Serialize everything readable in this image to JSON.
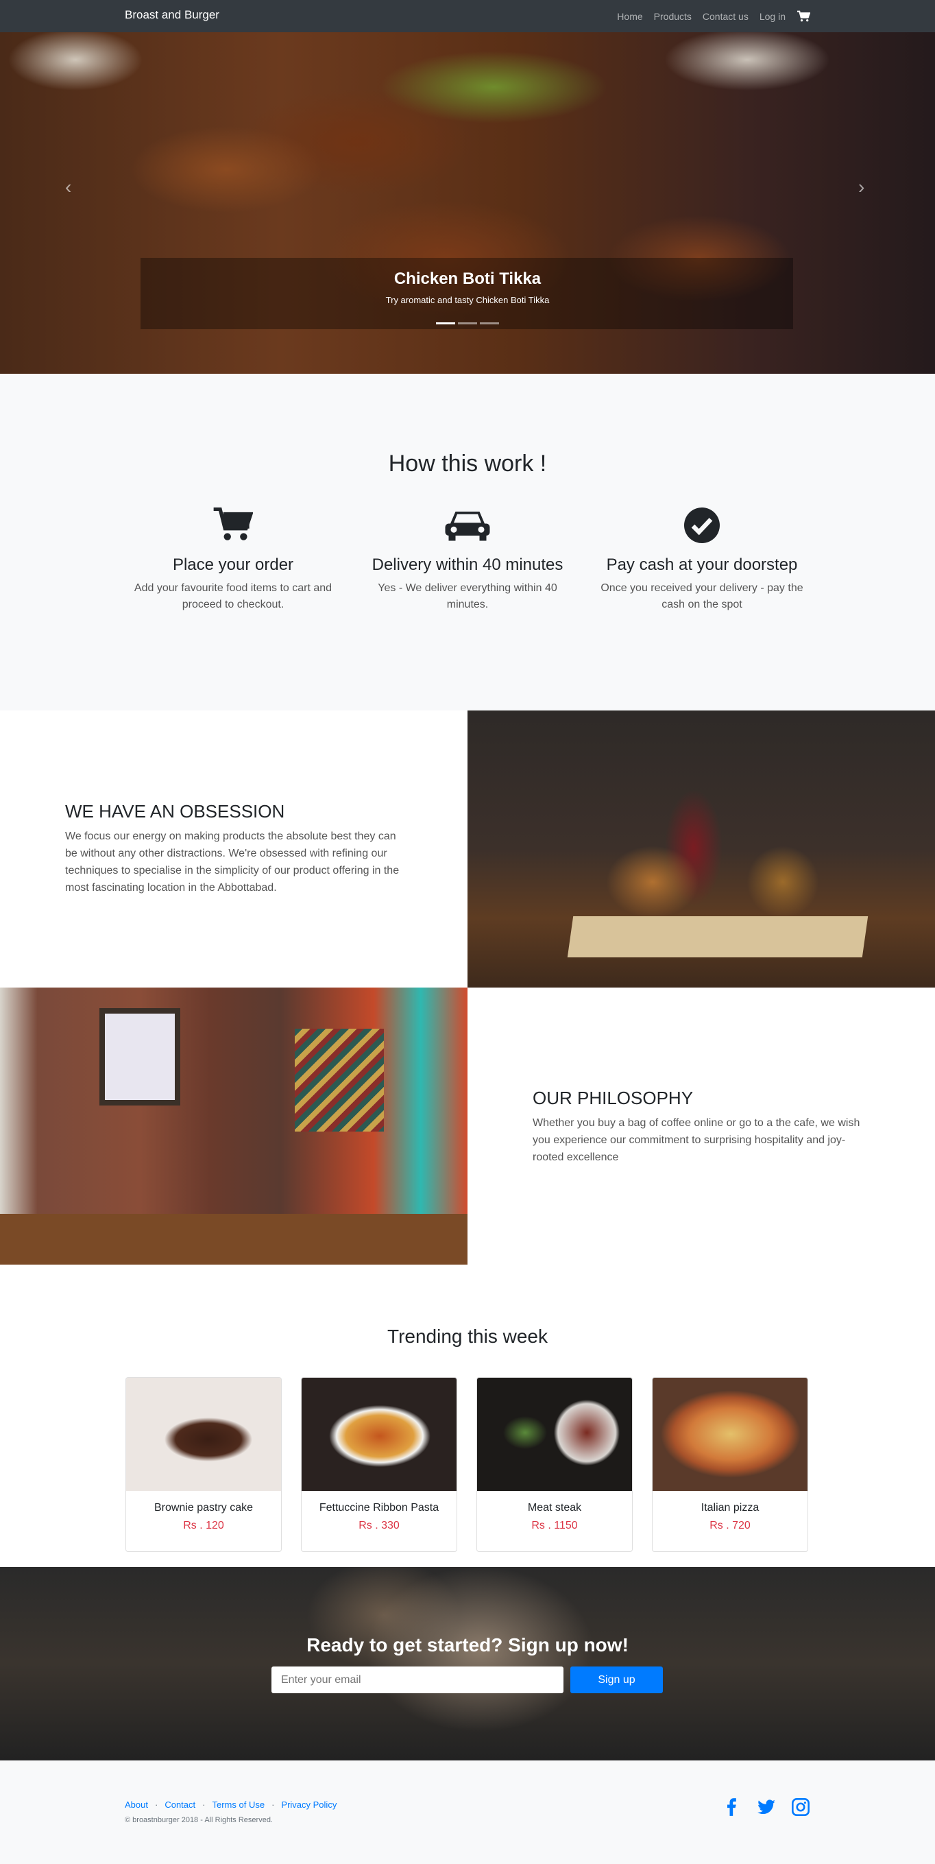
{
  "navbar": {
    "brand": "Broast and Burger",
    "links": [
      "Home",
      "Products",
      "Contact us",
      "Log in"
    ]
  },
  "hero": {
    "title": "Chicken Boti Tikka",
    "subtitle": "Try aromatic and tasty Chicken Boti Tikka",
    "slide_count": 3,
    "active_slide": 1
  },
  "how": {
    "title": "How this work !",
    "steps": [
      {
        "icon": "cart-icon",
        "title": "Place your order",
        "text": "Add your favourite food items to cart and proceed to checkout."
      },
      {
        "icon": "car-icon",
        "title": "Delivery within 40 minutes",
        "text": "Yes - We deliver everything within 40 minutes."
      },
      {
        "icon": "check-circle-icon",
        "title": "Pay cash at your doorstep",
        "text": "Once you received your delivery - pay the cash on the spot"
      }
    ]
  },
  "showcase": {
    "obsession": {
      "title": "WE HAVE AN OBSESSION",
      "text": "We focus our energy on making products the absolute best they can be without any other distractions. We're obsessed with refining our techniques to specialise in the simplicity of our product offering in the most fascinating location in the Abbottabad."
    },
    "philosophy": {
      "title": "OUR PHILOSOPHY",
      "text": "Whether you buy a bag of coffee online or go to a the cafe, we wish you experience our commitment to surprising hospitality and joy-rooted excellence"
    }
  },
  "trending": {
    "title": "Trending this week",
    "items": [
      {
        "name": "Brownie pastry cake",
        "price": "Rs . 120"
      },
      {
        "name": "Fettuccine Ribbon Pasta",
        "price": "Rs . 330"
      },
      {
        "name": "Meat steak",
        "price": "Rs . 1150"
      },
      {
        "name": "Italian pizza",
        "price": "Rs . 720"
      }
    ]
  },
  "signup": {
    "title": "Ready to get started? Sign up now!",
    "email_placeholder": "Enter your email",
    "button": "Sign up"
  },
  "footer": {
    "links": [
      "About",
      "Contact",
      "Terms of Use",
      "Privacy Policy"
    ],
    "separator": "·",
    "copyright": "© broastnburger 2018 - All Rights Reserved.",
    "social": [
      "facebook-icon",
      "twitter-icon",
      "instagram-icon"
    ]
  },
  "colors": {
    "navbar": "#343a40",
    "accent": "#007bff",
    "price": "#dc3545",
    "light_bg": "#f8f9fa"
  }
}
